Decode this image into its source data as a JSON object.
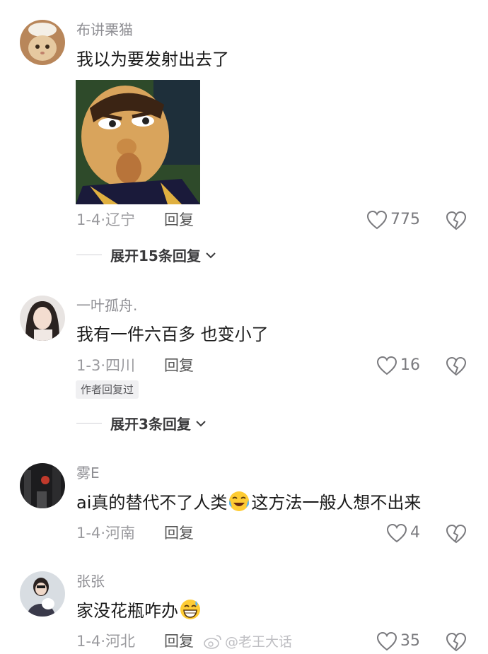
{
  "comments": [
    {
      "username": "布讲栗猫",
      "text": "我以为要发射出去了",
      "date": "1-4",
      "location": "辽宁",
      "reply_label": "回复",
      "likes": "775",
      "expand_label": "展开15条回复"
    },
    {
      "username": "一叶孤舟.",
      "text": "我有一件六百多 也变小了",
      "date": "1-3",
      "location": "四川",
      "reply_label": "回复",
      "likes": "16",
      "badge": "作者回复过",
      "expand_label": "展开3条回复"
    },
    {
      "username": "雾E",
      "text_before": "ai真的替代不了人类",
      "text_after": "这方法一般人想不出来",
      "emoji": "crying-laughing-emoji",
      "date": "1-4",
      "location": "河南",
      "reply_label": "回复",
      "likes": "4"
    },
    {
      "username": "张张",
      "text": "家没花瓶咋办",
      "emoji": "grinning-sweat-emoji",
      "date": "1-4",
      "location": "河北",
      "reply_label": "回复",
      "likes": "35"
    }
  ],
  "separator": "·",
  "watermark": "@老王大话",
  "colors": {
    "text": "#1a1a1a",
    "meta": "#9a9a9e",
    "username": "#8e8e93",
    "emoji": "#ffcc33"
  }
}
